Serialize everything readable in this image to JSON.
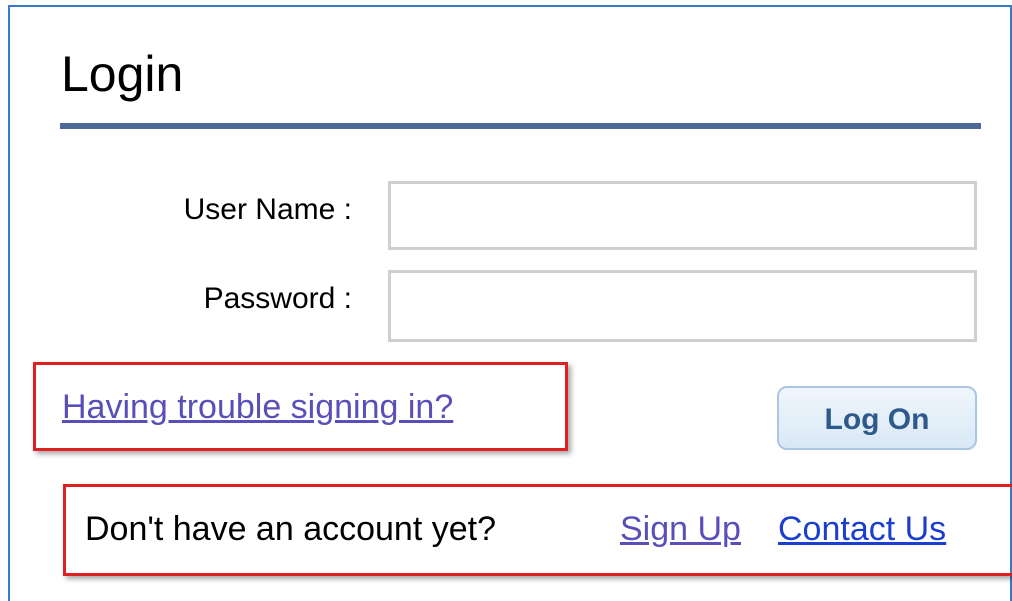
{
  "login": {
    "title": "Login",
    "username_label": "User Name :",
    "username_value": "",
    "password_label": "Password :",
    "password_value": "",
    "trouble_link": "Having trouble signing in?",
    "logon_button": "Log On",
    "no_account_text": "Don't have an account yet?",
    "signup_link": "Sign Up",
    "contact_link": "Contact Us"
  },
  "colors": {
    "frame_border": "#3a7bc8",
    "rule": "#4a6b9a",
    "highlight": "#e02020",
    "visited_link": "#5a4fb8",
    "link": "#1a3fcf",
    "button_text": "#2d5a8a"
  }
}
